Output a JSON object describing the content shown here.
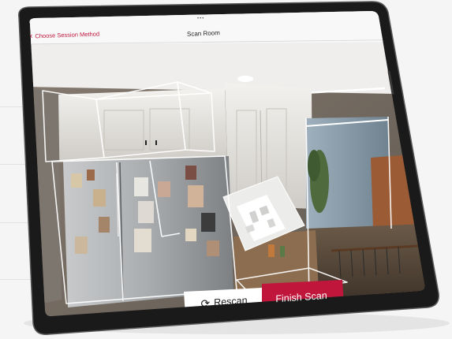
{
  "nav": {
    "back_label": "Choose Session Method",
    "back_icon": "chevron-left-icon",
    "title": "Scan Room",
    "multitask_dots": "•••"
  },
  "actions": {
    "rescan_label": "Rescan",
    "rescan_icon": "refresh-icon",
    "finish_label": "Finish Scan"
  },
  "colors": {
    "accent": "#c0163c",
    "device_frame": "#1a1a1a",
    "scan_outline": "#ffffff"
  }
}
